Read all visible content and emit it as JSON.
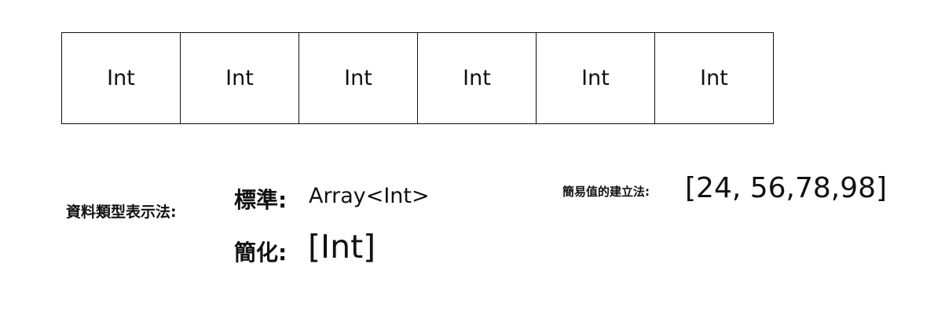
{
  "array_cells": [
    "Int",
    "Int",
    "Int",
    "Int",
    "Int",
    "Int"
  ],
  "type_notation": {
    "label": "資料類型表示法:",
    "standard_label": "標準:",
    "standard_value": "Array<Int>",
    "shorthand_label": "簡化:",
    "shorthand_value": "[Int]"
  },
  "literal": {
    "label": "簡易值的建立法:",
    "value": "[24, 56,78,98]"
  }
}
